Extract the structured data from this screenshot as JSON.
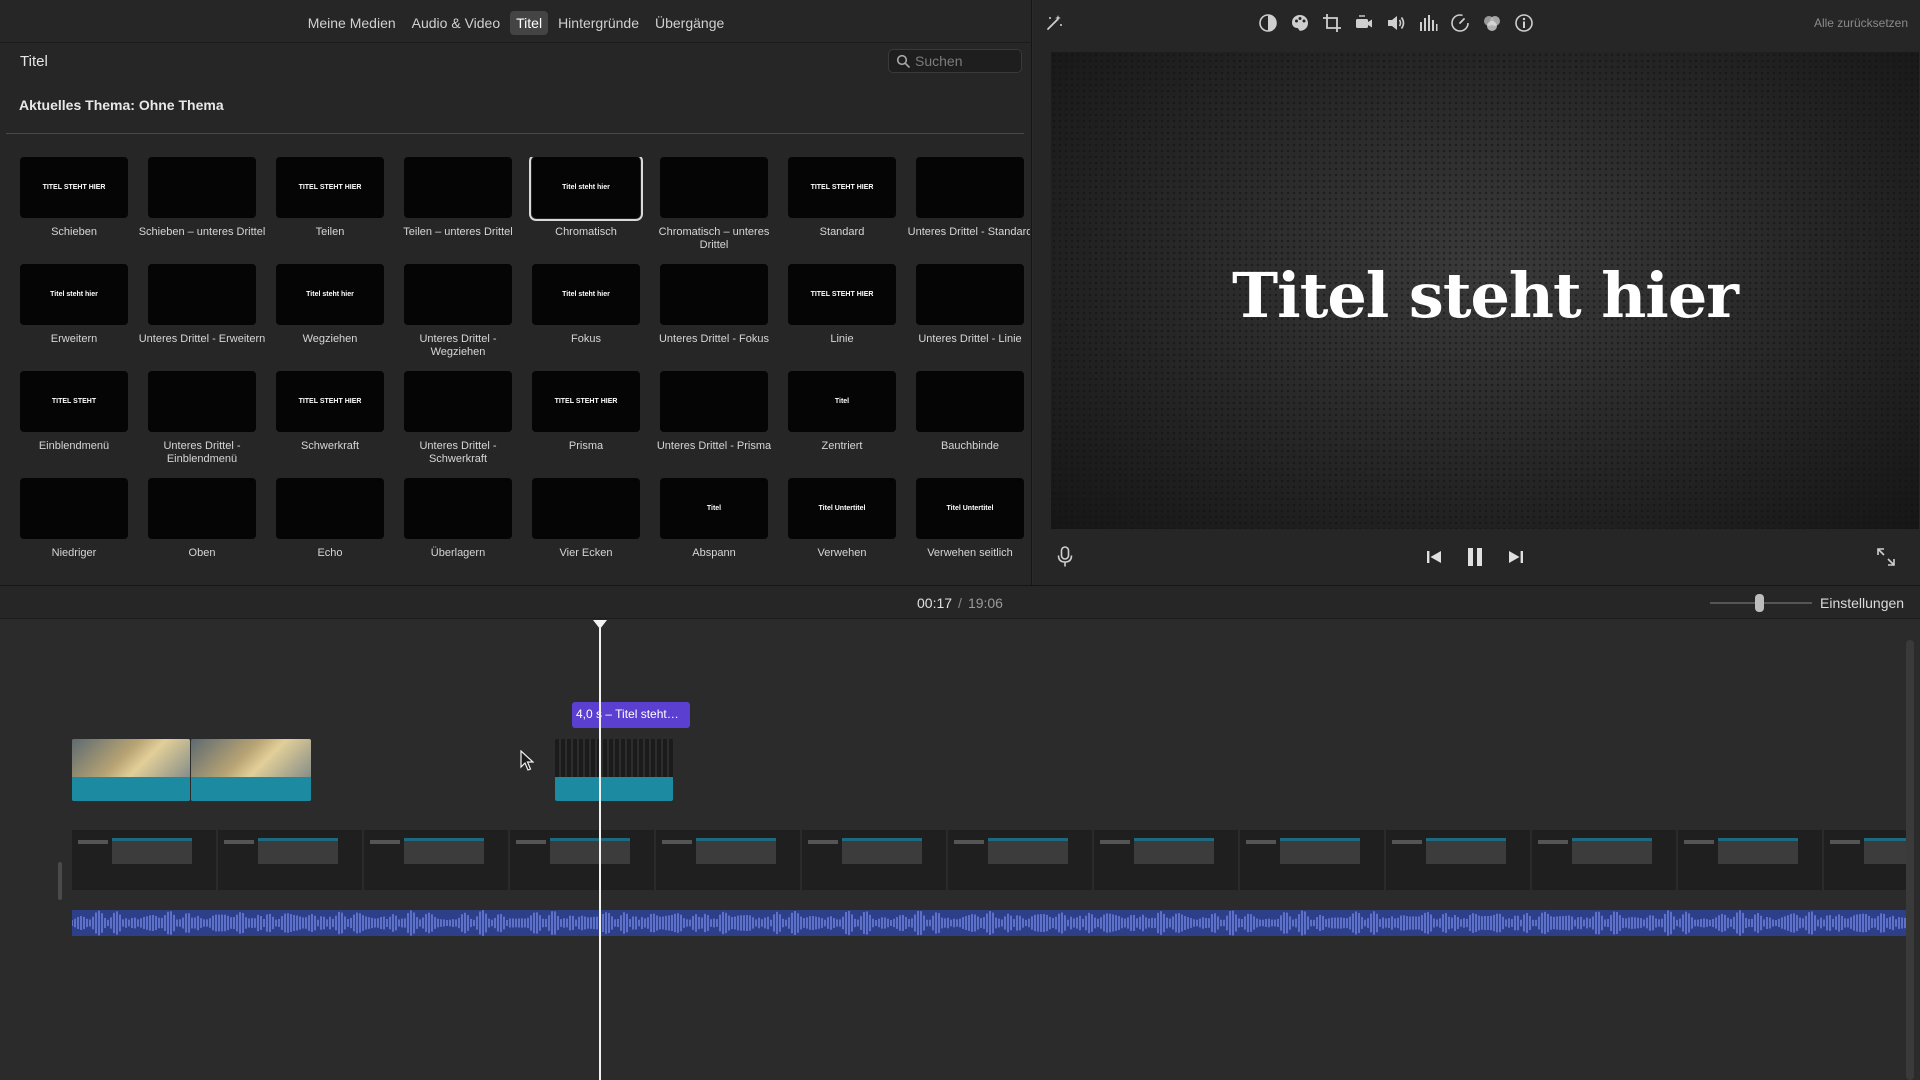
{
  "media_tabs": [
    {
      "label": "Meine Medien",
      "active": false
    },
    {
      "label": "Audio & Video",
      "active": false
    },
    {
      "label": "Titel",
      "active": true
    },
    {
      "label": "Hintergründe",
      "active": false
    },
    {
      "label": "Übergänge",
      "active": false
    }
  ],
  "browser": {
    "title": "Titel",
    "search_placeholder": "Suchen",
    "theme": "Aktuelles Thema: Ohne Thema"
  },
  "titles": [
    {
      "name": "Schieben",
      "thumb": "TITEL STEHT HIER"
    },
    {
      "name": "Schieben – unteres Drittel",
      "thumb": ""
    },
    {
      "name": "Teilen",
      "thumb": "TITEL STEHT HIER"
    },
    {
      "name": "Teilen – unteres Drittel",
      "thumb": ""
    },
    {
      "name": "Chromatisch",
      "thumb": "Titel steht hier",
      "selected": true
    },
    {
      "name": "Chromatisch – unteres Drittel",
      "thumb": ""
    },
    {
      "name": "Standard",
      "thumb": "TITEL STEHT HIER"
    },
    {
      "name": "Unteres Drittel - Standard",
      "thumb": ""
    },
    {
      "name": "Erweitern",
      "thumb": "Titel steht hier"
    },
    {
      "name": "Unteres Drittel - Erweitern",
      "thumb": ""
    },
    {
      "name": "Wegziehen",
      "thumb": "Titel steht hier"
    },
    {
      "name": "Unteres Drittel - Wegziehen",
      "thumb": ""
    },
    {
      "name": "Fokus",
      "thumb": "Titel steht hier"
    },
    {
      "name": "Unteres Drittel - Fokus",
      "thumb": ""
    },
    {
      "name": "Linie",
      "thumb": "TITEL STEHT HIER"
    },
    {
      "name": "Unteres Drittel - Linie",
      "thumb": ""
    },
    {
      "name": "Einblendmenü",
      "thumb": "TITEL STEHT"
    },
    {
      "name": "Unteres Drittel - Einblendmenü",
      "thumb": ""
    },
    {
      "name": "Schwerkraft",
      "thumb": "TITEL STEHT HIER"
    },
    {
      "name": "Unteres Drittel - Schwerkraft",
      "thumb": ""
    },
    {
      "name": "Prisma",
      "thumb": "TITEL STEHT HIER"
    },
    {
      "name": "Unteres Drittel - Prisma",
      "thumb": ""
    },
    {
      "name": "Zentriert",
      "thumb": "Titel"
    },
    {
      "name": "Bauchbinde",
      "thumb": ""
    },
    {
      "name": "Niedriger",
      "thumb": ""
    },
    {
      "name": "Oben",
      "thumb": ""
    },
    {
      "name": "Echo",
      "thumb": ""
    },
    {
      "name": "Überlagern",
      "thumb": ""
    },
    {
      "name": "Vier Ecken",
      "thumb": ""
    },
    {
      "name": "Abspann",
      "thumb": "Titel"
    },
    {
      "name": "Verwehen",
      "thumb": "Titel Untertitel"
    },
    {
      "name": "Verwehen seitlich",
      "thumb": "Titel Untertitel"
    }
  ],
  "viewer": {
    "reset_label": "Alle zurücksetzen",
    "preview_title": "Titel steht hier",
    "tools": [
      "magic-wand-icon",
      "color-balance-icon",
      "color-correction-icon",
      "crop-icon",
      "stabilization-icon",
      "volume-icon",
      "equalizer-icon",
      "speed-icon",
      "filter-icon",
      "info-icon"
    ]
  },
  "timebar": {
    "current": "00:17",
    "duration": "19:06",
    "settings_label": "Einstellungen"
  },
  "timeline": {
    "title_clip_label": "4,0 s – Titel steht…"
  },
  "colors": {
    "title_clip": "#5b3fd1",
    "video_band": "#1c8aa0",
    "audio_track": "#2e3f8a"
  }
}
